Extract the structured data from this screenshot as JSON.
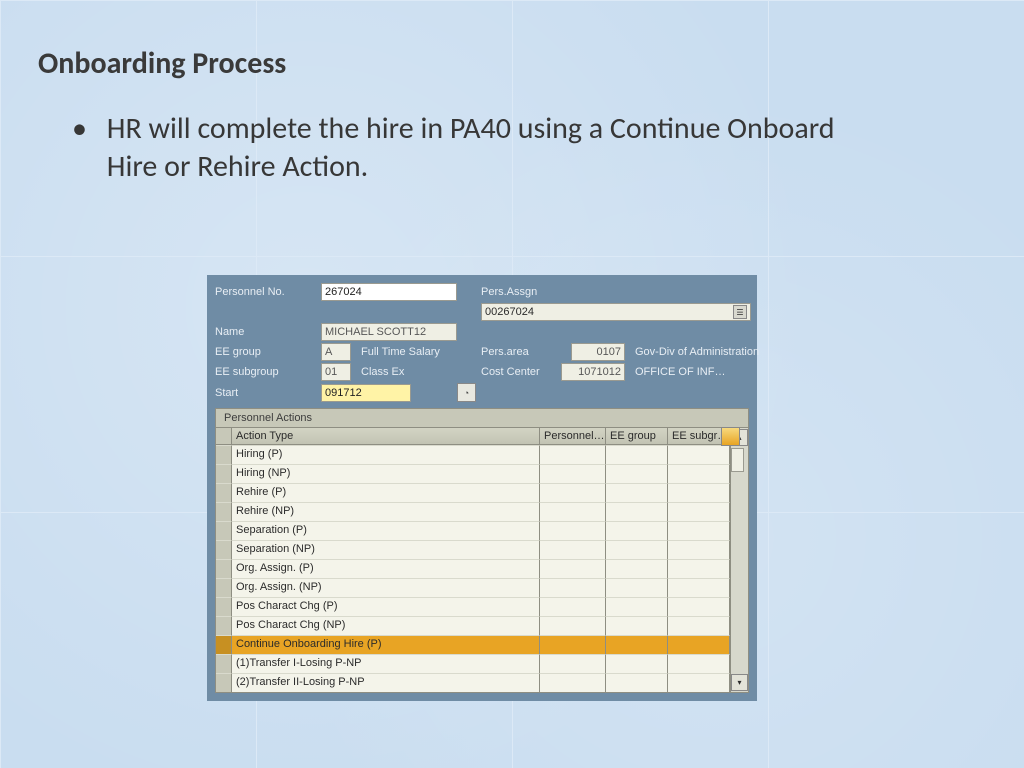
{
  "slide": {
    "title": "Onboarding Process",
    "bullet": "HR will complete the hire in PA40 using a Continue Onboard Hire or Rehire Action."
  },
  "sap": {
    "fields": {
      "personnel_no_label": "Personnel No.",
      "personnel_no": "267024",
      "pers_assgn_label": "Pers.Assgn",
      "pers_assgn": "00267024",
      "name_label": "Name",
      "name": "MICHAEL  SCOTT12",
      "ee_group_label": "EE group",
      "ee_group_code": "A",
      "ee_group_text": "Full Time Salary",
      "pers_area_label": "Pers.area",
      "pers_area_code": "0107",
      "pers_area_text": "Gov-Div of  Administration",
      "ee_subgroup_label": "EE subgroup",
      "ee_subgroup_code": "01",
      "ee_subgroup_text": "Class Ex",
      "cost_center_label": "Cost Center",
      "cost_center_code": "1071012",
      "cost_center_text": "OFFICE OF INF…",
      "start_label": "Start",
      "start": "091712"
    },
    "actions": {
      "panel_title": "Personnel Actions",
      "columns": [
        "Action Type",
        "Personnel…",
        "EE group",
        "EE subgr…"
      ],
      "selected_index": 10,
      "rows": [
        "Hiring (P)",
        "Hiring (NP)",
        "Rehire (P)",
        "Rehire (NP)",
        "Separation (P)",
        "Separation (NP)",
        "Org. Assign. (P)",
        "Org. Assign. (NP)",
        "Pos Charact Chg (P)",
        "Pos Charact Chg (NP)",
        "Continue Onboarding Hire (P)",
        "(1)Transfer I-Losing P-NP",
        "(2)Transfer II-Losing  P-NP"
      ]
    }
  }
}
